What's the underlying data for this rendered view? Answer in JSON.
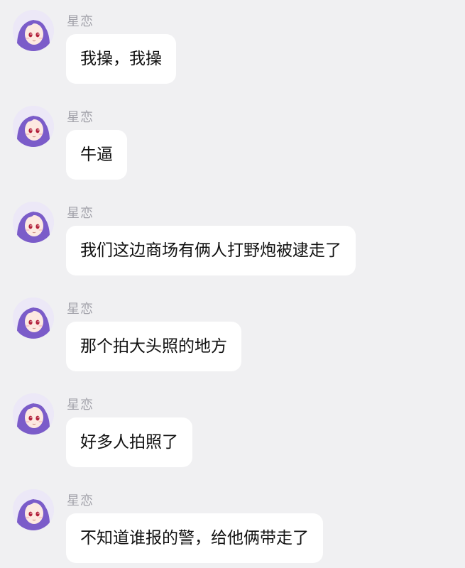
{
  "chat": {
    "messages": [
      {
        "sender": "星恋",
        "text": "我操，我操"
      },
      {
        "sender": "星恋",
        "text": "牛逼"
      },
      {
        "sender": "星恋",
        "text": "我们这边商场有俩人打野炮被逮走了"
      },
      {
        "sender": "星恋",
        "text": "那个拍大头照的地方"
      },
      {
        "sender": "星恋",
        "text": "好多人拍照了"
      },
      {
        "sender": "星恋",
        "text": "不知道谁报的警，给他俩带走了"
      }
    ]
  },
  "colors": {
    "background": "#f0f0f2",
    "bubble": "#ffffff",
    "sender_name": "#a2a2aa",
    "avatar_hair": "#7b5cc9"
  },
  "icons": {
    "avatar": "anime-avatar-icon"
  }
}
